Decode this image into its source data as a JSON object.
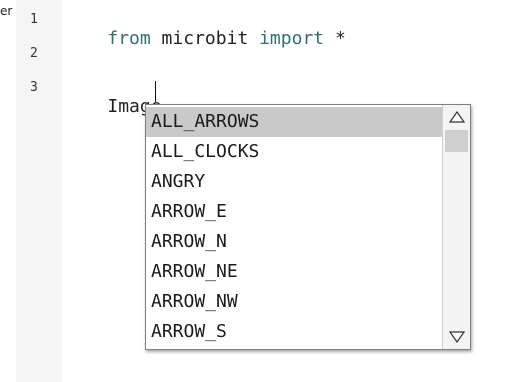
{
  "clipped_label": "er",
  "editor": {
    "lines": [
      {
        "number": "1",
        "parts": [
          {
            "text": "from",
            "kind": "kw"
          },
          {
            "text": " microbit ",
            "kind": "plain"
          },
          {
            "text": "import",
            "kind": "kw"
          },
          {
            "text": " *",
            "kind": "plain"
          }
        ]
      },
      {
        "number": "2",
        "parts": []
      },
      {
        "number": "3",
        "parts": [
          {
            "text": "Image.",
            "kind": "plain"
          }
        ]
      }
    ]
  },
  "autocomplete": {
    "selected_index": 0,
    "items": [
      "ALL_ARROWS",
      "ALL_CLOCKS",
      "ANGRY",
      "ARROW_E",
      "ARROW_N",
      "ARROW_NE",
      "ARROW_NW",
      "ARROW_S"
    ],
    "scroll_up_icon": "triangle-up-icon",
    "scroll_down_icon": "triangle-down-icon"
  },
  "colors": {
    "keyword": "#2f6f6f",
    "selection": "#c9c9c9",
    "gutter": "#f5f5f5"
  }
}
